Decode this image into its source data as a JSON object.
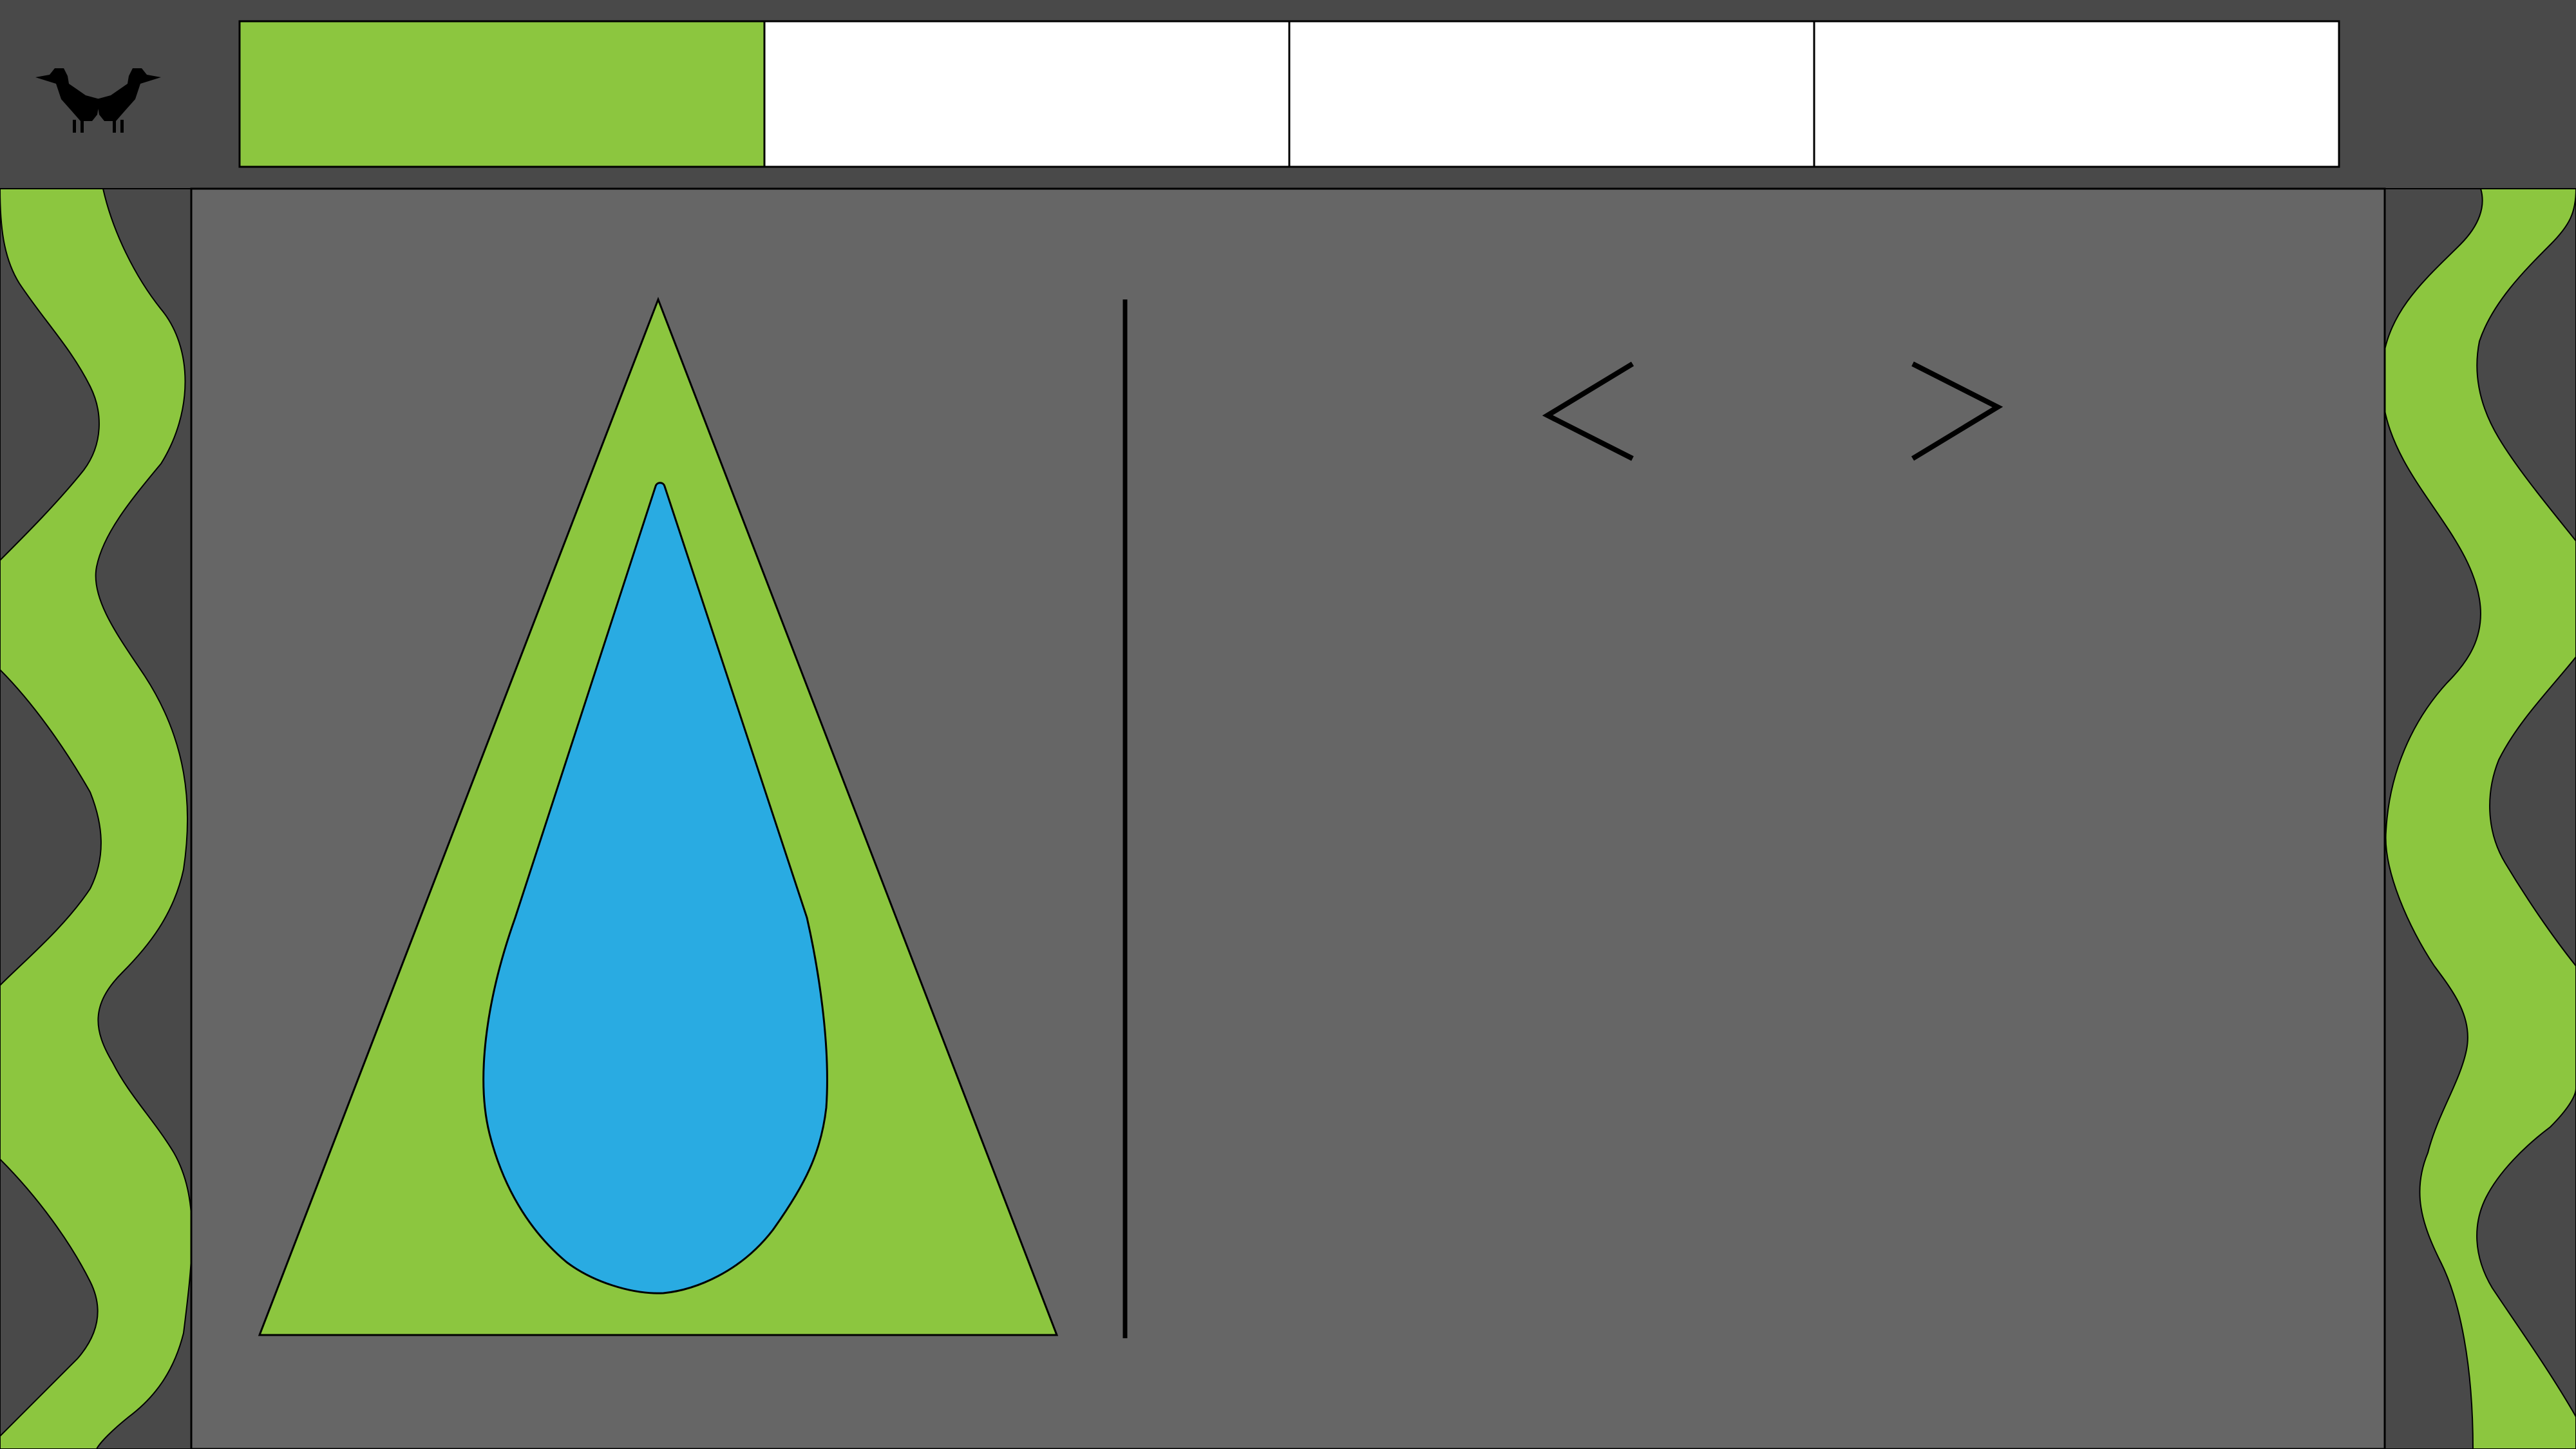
{
  "colors": {
    "frame_background": "#494949",
    "content_background": "#666666",
    "accent_green": "#8cc63f",
    "water_blue": "#29abe2",
    "outline": "#000000",
    "tab_inactive": "#ffffff"
  },
  "header": {
    "logo_icon": "two-birds-icon",
    "tabs": [
      {
        "label": "",
        "active": true
      },
      {
        "label": "",
        "active": false
      },
      {
        "label": "",
        "active": false
      },
      {
        "label": "",
        "active": false
      }
    ]
  },
  "main": {
    "hero_icon": "water-drop-in-triangle-icon",
    "navigation": {
      "previous_icon": "chevron-left-icon",
      "next_icon": "chevron-right-icon"
    }
  },
  "decorations": {
    "left_icon": "wavy-border-icon",
    "right_icon": "wavy-border-icon"
  }
}
